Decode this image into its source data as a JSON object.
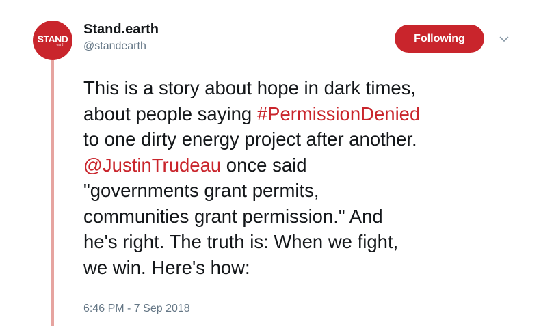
{
  "author": {
    "display_name": "Stand.earth",
    "handle": "@standearth",
    "avatar_word": "STAND",
    "avatar_sub": "earth"
  },
  "follow_button": {
    "label": "Following"
  },
  "menu": {
    "icon": "chevron-down-icon"
  },
  "tweet": {
    "lines": [
      {
        "before": "This is a story about hope in dark times,",
        "link": "",
        "after": ""
      },
      {
        "before": "about people saying ",
        "link": "#PermissionDenied",
        "after": ""
      },
      {
        "before": "to one dirty energy project after another.",
        "link": "",
        "after": ""
      },
      {
        "before": "",
        "link": "@JustinTrudeau",
        "after": " once said"
      },
      {
        "before": "\"governments grant permits,",
        "link": "",
        "after": ""
      },
      {
        "before": "communities grant permission.\" And",
        "link": "",
        "after": ""
      },
      {
        "before": "he's right. The truth is: When we fight,",
        "link": "",
        "after": ""
      },
      {
        "before": "we win. Here's how:",
        "link": "",
        "after": ""
      }
    ],
    "timestamp": "6:46 PM - 7 Sep 2018"
  },
  "colors": {
    "brand": "#c9252c",
    "thread_line": "#e6a4a0",
    "text": "#14171a",
    "muted": "#657786"
  }
}
